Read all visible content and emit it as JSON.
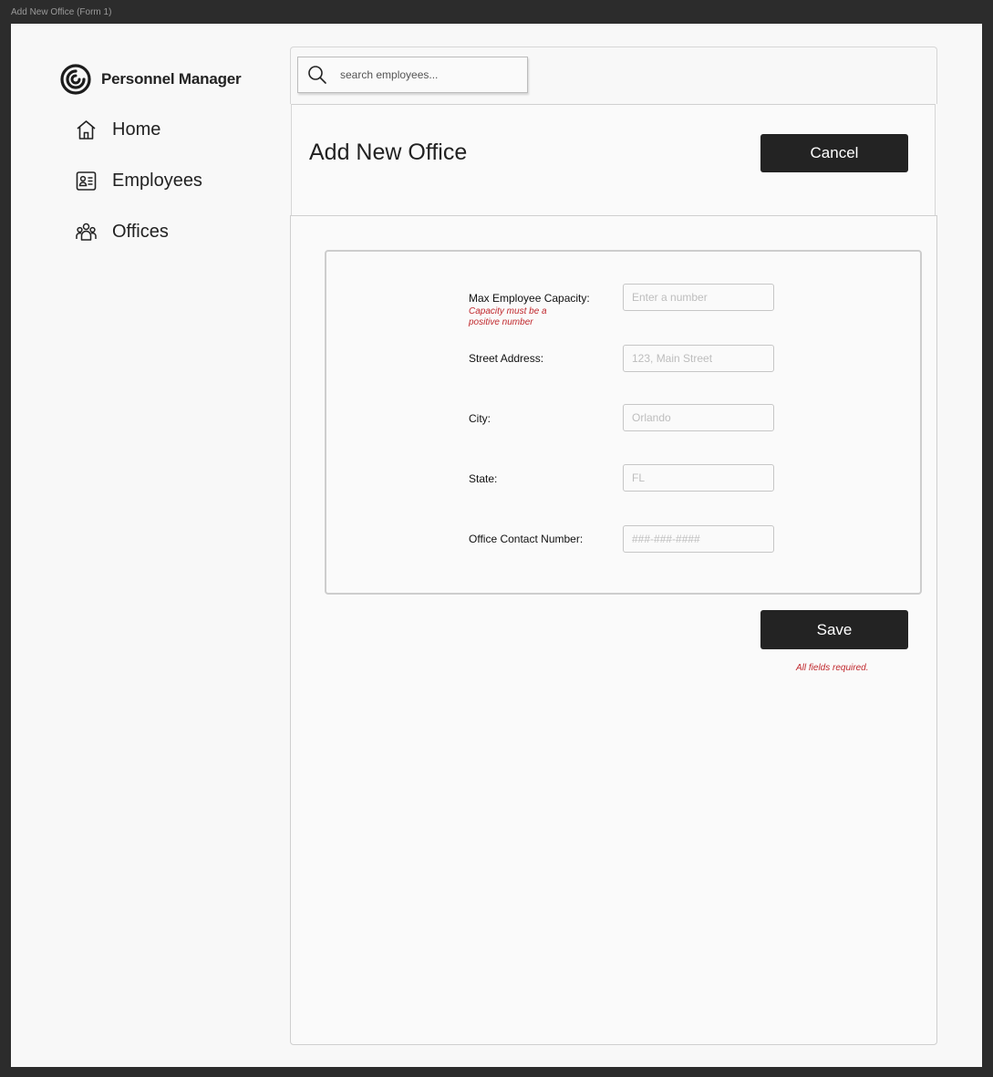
{
  "window": {
    "title": "Add New Office (Form 1)"
  },
  "sidebar": {
    "brand": "Personnel Manager",
    "items": [
      {
        "label": "Home",
        "icon": "home-icon"
      },
      {
        "label": "Employees",
        "icon": "id-card-icon"
      },
      {
        "label": "Offices",
        "icon": "people-group-icon"
      }
    ]
  },
  "search": {
    "placeholder": "search employees..."
  },
  "header": {
    "title": "Add New Office",
    "cancel_label": "Cancel"
  },
  "form": {
    "fields": [
      {
        "label": "Max Employee Capacity:",
        "placeholder": "Enter a number",
        "error": "Capacity must be a positive number"
      },
      {
        "label": "Street Address:",
        "placeholder": "123, Main Street"
      },
      {
        "label": "City:",
        "placeholder": "Orlando"
      },
      {
        "label": "State:",
        "placeholder": "FL"
      },
      {
        "label": "Office Contact Number:",
        "placeholder": "###-###-####"
      }
    ],
    "save_label": "Save",
    "required_note": "All fields required."
  },
  "colors": {
    "button": "#232323",
    "error": "#c0282d",
    "background": "#f8f8f8"
  }
}
